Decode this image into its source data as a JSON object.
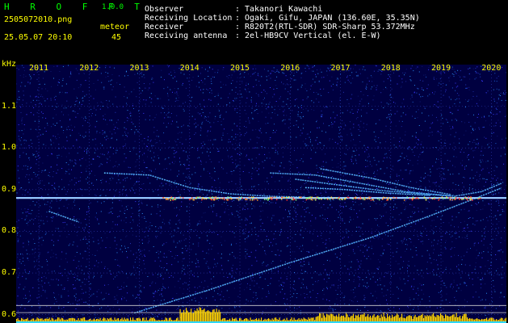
{
  "app": {
    "name": "H R O F F T",
    "version": "1.0.0",
    "filename": "2505072010.png",
    "datetime": "25.05.07 20:10",
    "meteor_label": "meteor",
    "meteor_count": "45"
  },
  "info": {
    "rows": [
      {
        "label": "Observer",
        "sep": ":",
        "value": "Takanori Kawachi"
      },
      {
        "label": "Receiving Location",
        "sep": ":",
        "value": "Ogaki, Gifu, JAPAN (136.60E, 35.35N)"
      },
      {
        "label": "Receiver",
        "sep": ":",
        "value": "R820T2(RTL-SDR) SDR-Sharp 53.372MHz"
      },
      {
        "label": "Receiving antenna",
        "sep": ":",
        "value": "2el-HB9CV Vertical (el. E-W)"
      }
    ]
  },
  "chart_data": {
    "type": "heatmap",
    "ylabel": "kHz",
    "y_ticks": [
      "1.1",
      "1.0",
      "0.9",
      "0.8",
      "0.7",
      "0.6"
    ],
    "y_tick_values": [
      1.1,
      1.0,
      0.9,
      0.8,
      0.7,
      0.6
    ],
    "ylim": [
      0.58,
      1.2
    ],
    "x_ticks": [
      "2011",
      "2012",
      "2013",
      "2014",
      "2015",
      "2016",
      "2017",
      "2018",
      "2019",
      "2020"
    ],
    "xlim": [
      2010.55,
      2020.3
    ],
    "carrier_khz": 0.88,
    "reference_lines_khz": [
      0.622,
      0.605
    ],
    "traces": [
      {
        "points": [
          [
            2011.2,
            0.848
          ],
          [
            2011.8,
            0.822
          ]
        ]
      },
      {
        "points": [
          [
            2012.9,
            0.604
          ],
          [
            2014.4,
            0.66
          ],
          [
            2016.0,
            0.725
          ],
          [
            2017.6,
            0.785
          ],
          [
            2018.8,
            0.838
          ],
          [
            2019.6,
            0.875
          ],
          [
            2020.2,
            0.904
          ]
        ]
      },
      {
        "points": [
          [
            2012.3,
            0.94
          ],
          [
            2013.2,
            0.935
          ],
          [
            2014.0,
            0.905
          ],
          [
            2014.8,
            0.89
          ],
          [
            2015.6,
            0.884
          ],
          [
            2016.3,
            0.882
          ]
        ]
      },
      {
        "points": [
          [
            2015.6,
            0.94
          ],
          [
            2016.5,
            0.935
          ],
          [
            2017.4,
            0.915
          ],
          [
            2018.3,
            0.895
          ],
          [
            2019.2,
            0.885
          ]
        ]
      },
      {
        "points": [
          [
            2016.1,
            0.925
          ],
          [
            2016.9,
            0.912
          ],
          [
            2017.8,
            0.898
          ],
          [
            2018.6,
            0.89
          ],
          [
            2019.3,
            0.884
          ]
        ]
      },
      {
        "points": [
          [
            2016.6,
            0.95
          ],
          [
            2017.6,
            0.928
          ],
          [
            2018.4,
            0.905
          ],
          [
            2019.2,
            0.888
          ]
        ]
      },
      {
        "points": [
          [
            2016.3,
            0.905
          ],
          [
            2017.1,
            0.9
          ],
          [
            2017.9,
            0.892
          ],
          [
            2018.8,
            0.886
          ]
        ]
      },
      {
        "points": [
          [
            2019.3,
            0.885
          ],
          [
            2019.8,
            0.895
          ],
          [
            2020.2,
            0.915
          ]
        ]
      }
    ]
  },
  "colors": {
    "label": "#00ff00",
    "axis": "#ffff00",
    "info": "#ffffff",
    "noise_bg": "#000040",
    "carrier": "#7ab8ff",
    "bars": "#ffd400",
    "trace": "#4aa0ff",
    "trace_hot": "#7cffd0"
  }
}
